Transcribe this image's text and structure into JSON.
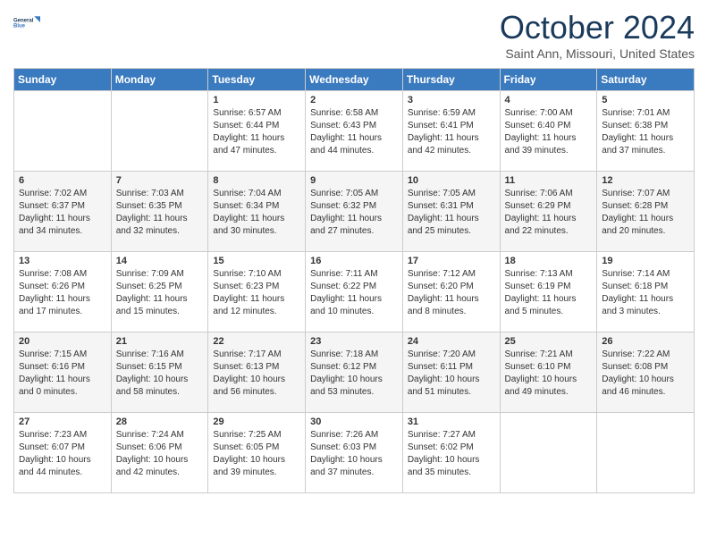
{
  "logo": {
    "line1": "General",
    "line2": "Blue"
  },
  "title": "October 2024",
  "location": "Saint Ann, Missouri, United States",
  "days_of_week": [
    "Sunday",
    "Monday",
    "Tuesday",
    "Wednesday",
    "Thursday",
    "Friday",
    "Saturday"
  ],
  "weeks": [
    [
      {
        "day": "",
        "content": ""
      },
      {
        "day": "",
        "content": ""
      },
      {
        "day": "1",
        "content": "Sunrise: 6:57 AM\nSunset: 6:44 PM\nDaylight: 11 hours and 47 minutes."
      },
      {
        "day": "2",
        "content": "Sunrise: 6:58 AM\nSunset: 6:43 PM\nDaylight: 11 hours and 44 minutes."
      },
      {
        "day": "3",
        "content": "Sunrise: 6:59 AM\nSunset: 6:41 PM\nDaylight: 11 hours and 42 minutes."
      },
      {
        "day": "4",
        "content": "Sunrise: 7:00 AM\nSunset: 6:40 PM\nDaylight: 11 hours and 39 minutes."
      },
      {
        "day": "5",
        "content": "Sunrise: 7:01 AM\nSunset: 6:38 PM\nDaylight: 11 hours and 37 minutes."
      }
    ],
    [
      {
        "day": "6",
        "content": "Sunrise: 7:02 AM\nSunset: 6:37 PM\nDaylight: 11 hours and 34 minutes."
      },
      {
        "day": "7",
        "content": "Sunrise: 7:03 AM\nSunset: 6:35 PM\nDaylight: 11 hours and 32 minutes."
      },
      {
        "day": "8",
        "content": "Sunrise: 7:04 AM\nSunset: 6:34 PM\nDaylight: 11 hours and 30 minutes."
      },
      {
        "day": "9",
        "content": "Sunrise: 7:05 AM\nSunset: 6:32 PM\nDaylight: 11 hours and 27 minutes."
      },
      {
        "day": "10",
        "content": "Sunrise: 7:05 AM\nSunset: 6:31 PM\nDaylight: 11 hours and 25 minutes."
      },
      {
        "day": "11",
        "content": "Sunrise: 7:06 AM\nSunset: 6:29 PM\nDaylight: 11 hours and 22 minutes."
      },
      {
        "day": "12",
        "content": "Sunrise: 7:07 AM\nSunset: 6:28 PM\nDaylight: 11 hours and 20 minutes."
      }
    ],
    [
      {
        "day": "13",
        "content": "Sunrise: 7:08 AM\nSunset: 6:26 PM\nDaylight: 11 hours and 17 minutes."
      },
      {
        "day": "14",
        "content": "Sunrise: 7:09 AM\nSunset: 6:25 PM\nDaylight: 11 hours and 15 minutes."
      },
      {
        "day": "15",
        "content": "Sunrise: 7:10 AM\nSunset: 6:23 PM\nDaylight: 11 hours and 12 minutes."
      },
      {
        "day": "16",
        "content": "Sunrise: 7:11 AM\nSunset: 6:22 PM\nDaylight: 11 hours and 10 minutes."
      },
      {
        "day": "17",
        "content": "Sunrise: 7:12 AM\nSunset: 6:20 PM\nDaylight: 11 hours and 8 minutes."
      },
      {
        "day": "18",
        "content": "Sunrise: 7:13 AM\nSunset: 6:19 PM\nDaylight: 11 hours and 5 minutes."
      },
      {
        "day": "19",
        "content": "Sunrise: 7:14 AM\nSunset: 6:18 PM\nDaylight: 11 hours and 3 minutes."
      }
    ],
    [
      {
        "day": "20",
        "content": "Sunrise: 7:15 AM\nSunset: 6:16 PM\nDaylight: 11 hours and 0 minutes."
      },
      {
        "day": "21",
        "content": "Sunrise: 7:16 AM\nSunset: 6:15 PM\nDaylight: 10 hours and 58 minutes."
      },
      {
        "day": "22",
        "content": "Sunrise: 7:17 AM\nSunset: 6:13 PM\nDaylight: 10 hours and 56 minutes."
      },
      {
        "day": "23",
        "content": "Sunrise: 7:18 AM\nSunset: 6:12 PM\nDaylight: 10 hours and 53 minutes."
      },
      {
        "day": "24",
        "content": "Sunrise: 7:20 AM\nSunset: 6:11 PM\nDaylight: 10 hours and 51 minutes."
      },
      {
        "day": "25",
        "content": "Sunrise: 7:21 AM\nSunset: 6:10 PM\nDaylight: 10 hours and 49 minutes."
      },
      {
        "day": "26",
        "content": "Sunrise: 7:22 AM\nSunset: 6:08 PM\nDaylight: 10 hours and 46 minutes."
      }
    ],
    [
      {
        "day": "27",
        "content": "Sunrise: 7:23 AM\nSunset: 6:07 PM\nDaylight: 10 hours and 44 minutes."
      },
      {
        "day": "28",
        "content": "Sunrise: 7:24 AM\nSunset: 6:06 PM\nDaylight: 10 hours and 42 minutes."
      },
      {
        "day": "29",
        "content": "Sunrise: 7:25 AM\nSunset: 6:05 PM\nDaylight: 10 hours and 39 minutes."
      },
      {
        "day": "30",
        "content": "Sunrise: 7:26 AM\nSunset: 6:03 PM\nDaylight: 10 hours and 37 minutes."
      },
      {
        "day": "31",
        "content": "Sunrise: 7:27 AM\nSunset: 6:02 PM\nDaylight: 10 hours and 35 minutes."
      },
      {
        "day": "",
        "content": ""
      },
      {
        "day": "",
        "content": ""
      }
    ]
  ]
}
